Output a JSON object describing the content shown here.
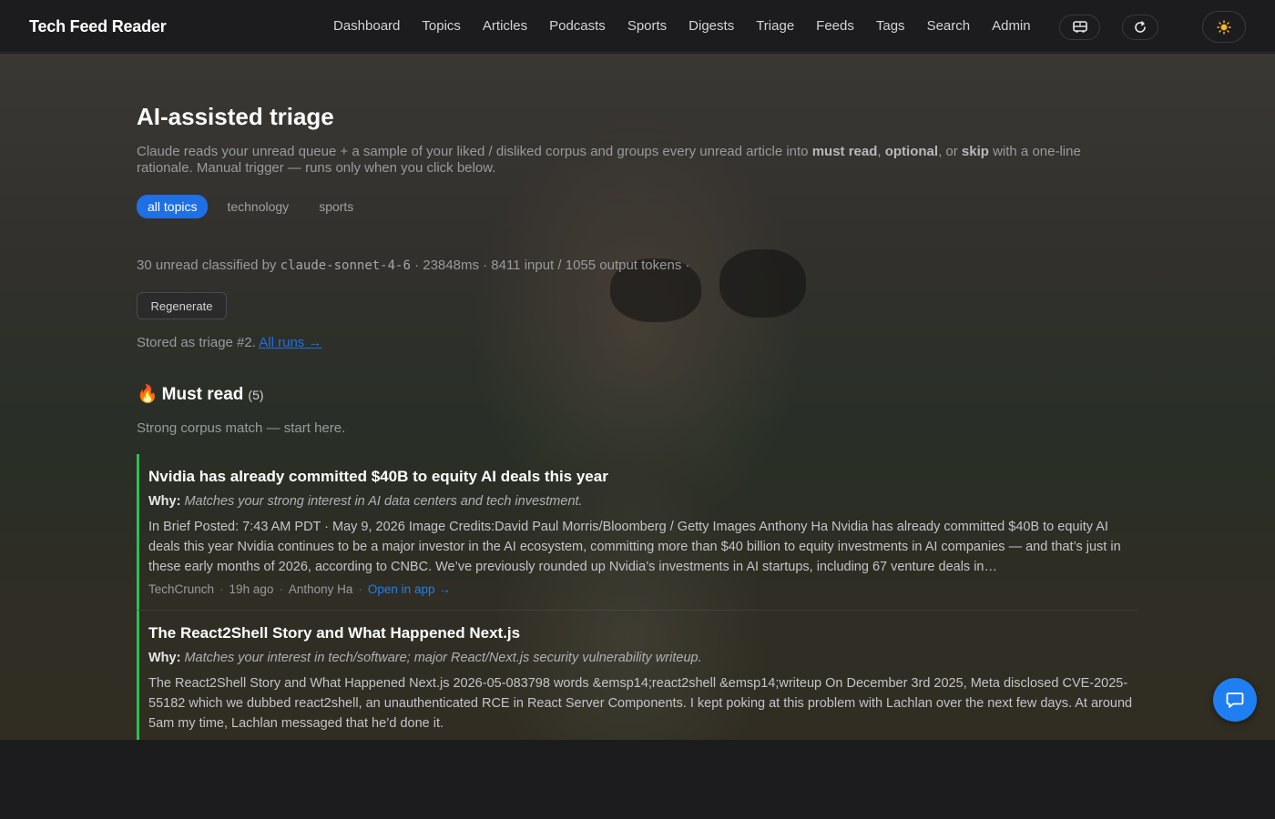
{
  "app": {
    "title": "Tech Feed Reader"
  },
  "nav": {
    "items": [
      {
        "label": "Dashboard"
      },
      {
        "label": "Topics"
      },
      {
        "label": "Articles"
      },
      {
        "label": "Podcasts"
      },
      {
        "label": "Sports"
      },
      {
        "label": "Digests"
      },
      {
        "label": "Triage"
      },
      {
        "label": "Feeds"
      },
      {
        "label": "Tags"
      },
      {
        "label": "Search"
      },
      {
        "label": "Admin"
      }
    ],
    "icons": [
      "bus-icon",
      "refresh-icon",
      "sun-icon"
    ]
  },
  "page": {
    "title": "AI-assisted triage",
    "intro_1": "Claude reads your unread queue + a sample of your liked / disliked corpus and groups every unread article into ",
    "must_read": "must read",
    "comma": ", ",
    "optional": "optional",
    "or": ", or ",
    "skip": "skip",
    "intro_2": " with a one-line rationale. Manual trigger — runs only when you click below."
  },
  "topics": {
    "chips": [
      {
        "label": "all topics",
        "active": true
      },
      {
        "label": "technology",
        "active": false
      },
      {
        "label": "sports",
        "active": false
      }
    ]
  },
  "run": {
    "stats_pre": "30 unread classified by ",
    "model": "claude-sonnet-4-6",
    "stats_post": " · 23848ms · 8411 input / 1055 output tokens ·",
    "regenerate_label": "Regenerate",
    "stored_text": "Stored as triage #2. ",
    "all_runs_link": "All runs →"
  },
  "section": {
    "icon": "🔥",
    "title": "Must read",
    "count": "(5)",
    "subtitle": "Strong corpus match — start here."
  },
  "articles": [
    {
      "title": "Nvidia has already committed $40B to equity AI deals this year",
      "why_label": "Why:",
      "why": "Matches your strong interest in AI data centers and tech investment.",
      "summary": "In Brief Posted: 7:43 AM PDT · May 9, 2026 Image Credits:David Paul Morris/Bloomberg / Getty Images Anthony Ha Nvidia has already committed $40B to equity AI deals this year Nvidia continues to be a major investor in the AI ecosystem, committing more than $40 billion to equity investments in AI companies — and that’s just in these early months of 2026, according to CNBC. We’ve previously rounded up Nvidia’s investments in AI startups, including 67 venture deals in…",
      "source": "TechCrunch",
      "age": "19h ago",
      "author": "Anthony Ha",
      "open_link": "Open in app →"
    },
    {
      "title": "The React2Shell Story and What Happened Next.js",
      "why_label": "Why:",
      "why": "Matches your interest in tech/software; major React/Next.js security vulnerability writeup.",
      "summary": "The React2Shell Story and What Happened Next.js 2026-05-083798 words &emsp14;react2shell &emsp14;writeup On December 3rd 2025, Meta disclosed CVE-2025-55182 which we dubbed react2shell, an unauthenticated RCE in React Server Components. I kept poking at this problem with Lachlan over the next few days. At around 5am my time, Lachlan messaged that he’d done it."
    }
  ],
  "colors": {
    "accent": "#1f6fe5",
    "must_read_border": "#30c050",
    "background": "#1c1c1e"
  }
}
